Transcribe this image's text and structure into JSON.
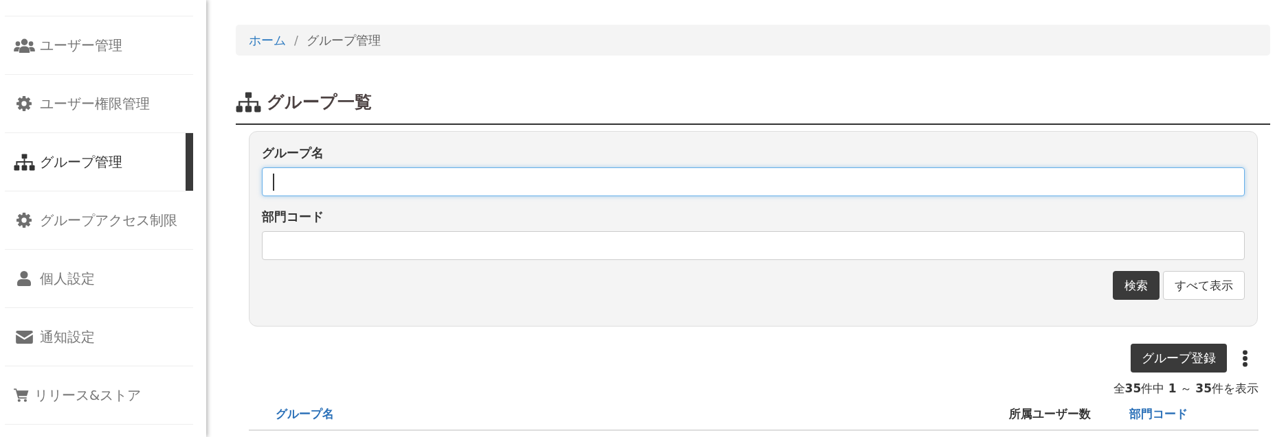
{
  "sidebar": {
    "items": [
      {
        "label": "ユーザー管理",
        "selected": false
      },
      {
        "label": "ユーザー権限管理",
        "selected": false
      },
      {
        "label": "グループ管理",
        "selected": true
      },
      {
        "label": "グループアクセス制限",
        "selected": false
      },
      {
        "label": "個人設定",
        "selected": false
      },
      {
        "label": "通知設定",
        "selected": false
      },
      {
        "label": "リリース&ストア",
        "selected": false
      }
    ]
  },
  "breadcrumb": {
    "items": [
      {
        "label": "ホーム",
        "kind": "link"
      },
      {
        "label": "グループ管理",
        "kind": "current"
      }
    ],
    "separator": "/"
  },
  "page_title": "グループ一覧",
  "search_panel": {
    "fields": [
      {
        "label": "グループ名",
        "focused": true
      },
      {
        "label": "部門コード",
        "focused": false
      }
    ],
    "buttons": [
      {
        "label": "検索",
        "kind": "primary"
      },
      {
        "label": "すべて表示",
        "kind": "default"
      }
    ]
  },
  "toolbar": {
    "register_button": "グループ登録"
  },
  "result_count": "全**35**件中 **1** ～ **35**件を表示",
  "table": {
    "columns": [
      {
        "label": "グループ名",
        "sortable": true
      },
      {
        "label": "所属ユーザー数",
        "sortable": false
      },
      {
        "label": "部門コード",
        "sortable": true
      }
    ]
  }
}
